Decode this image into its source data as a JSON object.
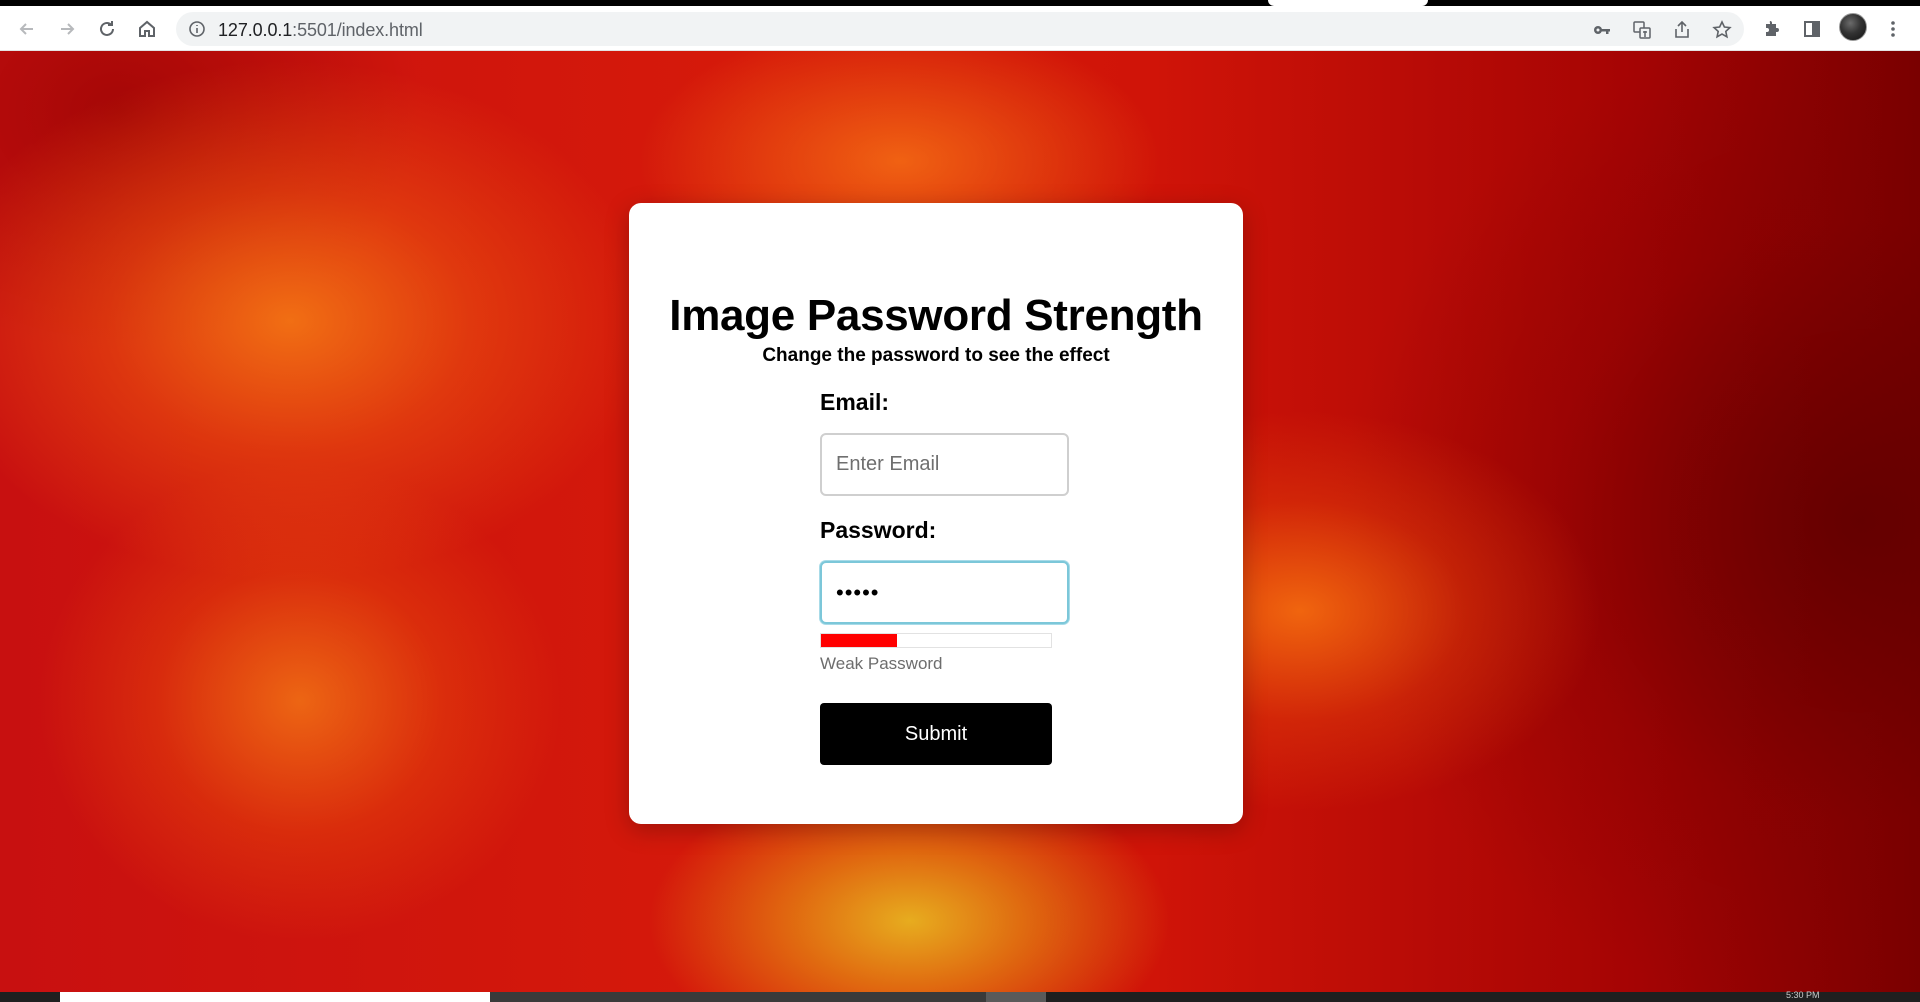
{
  "browser": {
    "url_host": "127.0.0.1",
    "url_rest": ":5501/index.html",
    "icons": [
      "back-icon",
      "forward-icon",
      "reload-icon",
      "home-icon",
      "info-icon",
      "key-icon",
      "translate-icon",
      "share-icon",
      "star-icon",
      "extensions-icon",
      "side-panel-icon",
      "avatar",
      "menu-icon"
    ]
  },
  "page": {
    "title": "Image Password Strength",
    "subtitle": "Change the password to see the effect",
    "email": {
      "label": "Email:",
      "placeholder": "Enter Email",
      "value": ""
    },
    "password": {
      "label": "Password:",
      "value": "•••••"
    },
    "strength": {
      "level": 0.33,
      "color": "#ff0000",
      "text": "Weak Password"
    },
    "submit_label": "Submit"
  },
  "taskbar": {
    "time": "5:30 PM"
  }
}
